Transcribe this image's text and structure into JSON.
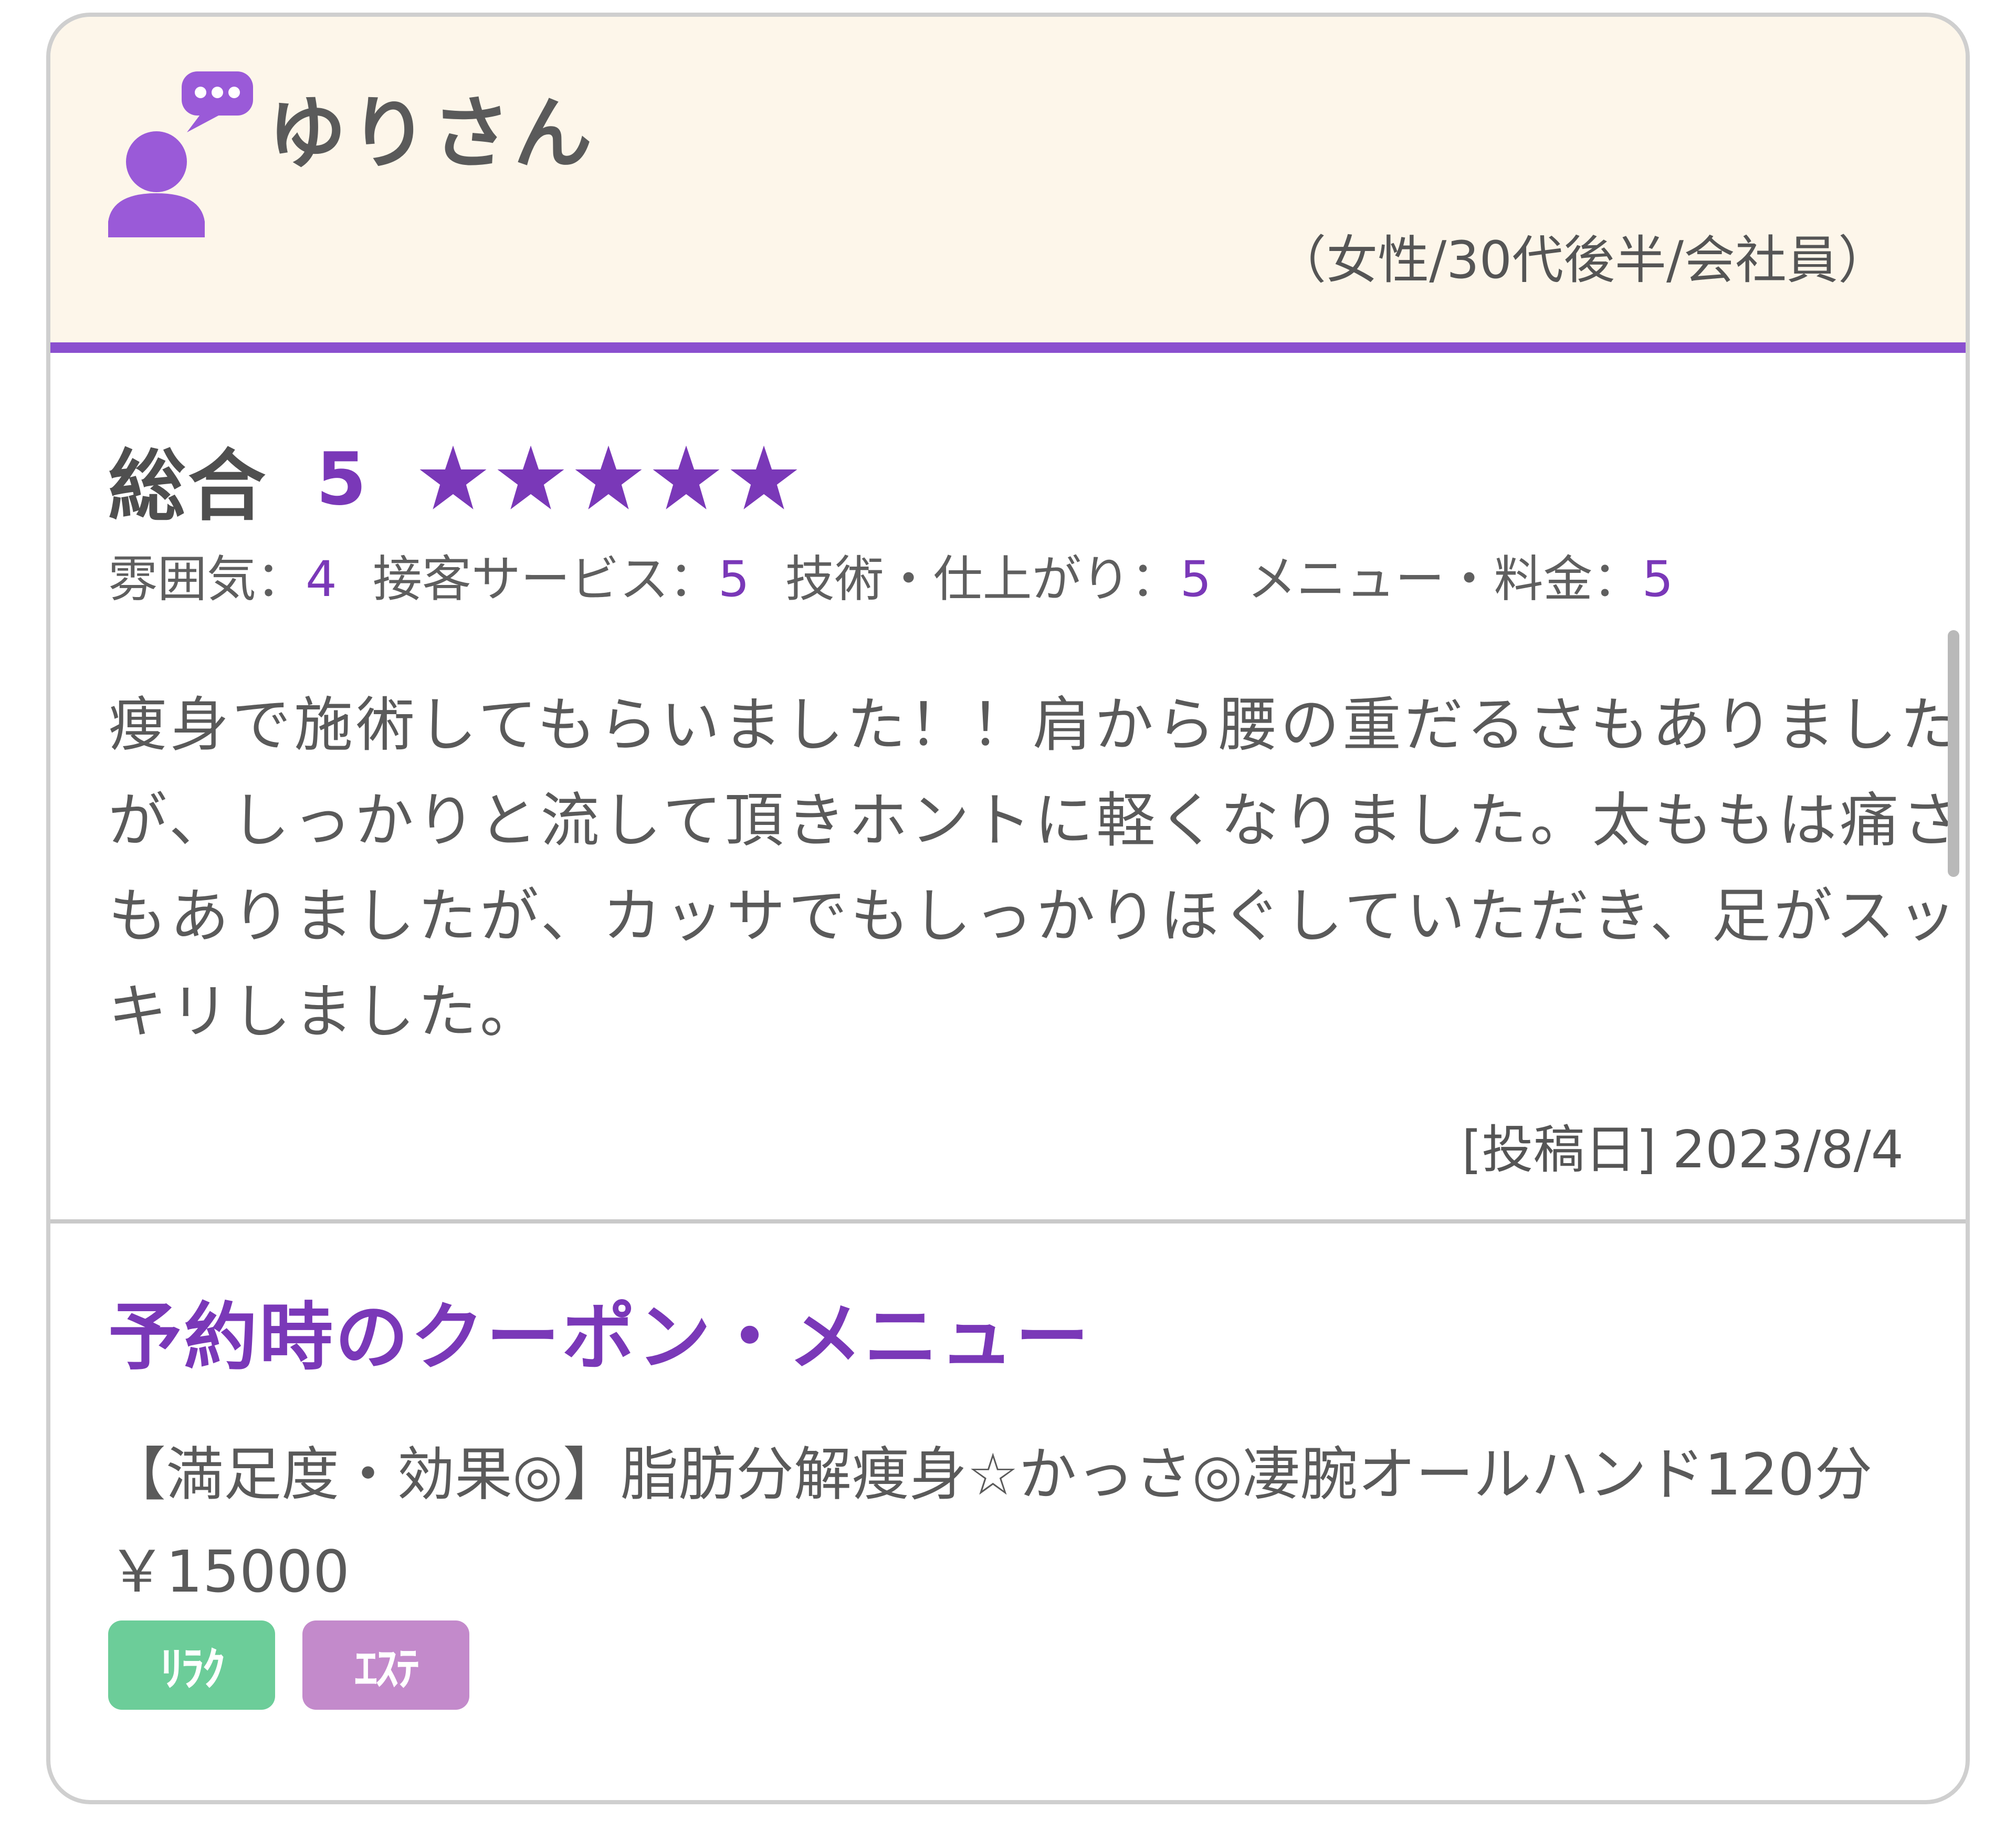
{
  "reviewer": {
    "name": "ゆりさん",
    "profile": "（女性/30代後半/会社員）"
  },
  "rating": {
    "overall_label": "総合",
    "overall_value": "5",
    "stars_count": 5,
    "sub_ratings": [
      {
        "label": "雰囲気：",
        "value": "4"
      },
      {
        "label": "接客サービス：",
        "value": "5"
      },
      {
        "label": "技術・仕上がり：",
        "value": "5"
      },
      {
        "label": "メニュー・料金：",
        "value": "5"
      }
    ]
  },
  "review": {
    "body": "痩身で施術してもらいました！！肩から腰の重だるさもありましたが、しっかりと流して頂きホントに軽くなりました。太ももは痛さもありましたが、カッサでもしっかりほぐしていただき、足がスッキリしました。",
    "post_date": "[投稿日] 2023/8/4"
  },
  "coupon": {
    "heading": "予約時のクーポン・メニュー",
    "text": "【満足度・効果◎】脂肪分解痩身☆かっさ◎凄腕オールハンド120分￥15000",
    "tags": [
      {
        "label": "ﾘﾗｸ",
        "color": "#6ccd99"
      },
      {
        "label": "ｴｽﾃ",
        "color": "#c38acb"
      }
    ]
  },
  "colors": {
    "accent": "#7a38b8",
    "header_background": "#fdf6ea",
    "header_border": "#8a4fcf",
    "card_border": "#cfcfcf"
  },
  "icons": {
    "reviewer": "user-speech-bubble-icon",
    "rating": "star-icon"
  }
}
